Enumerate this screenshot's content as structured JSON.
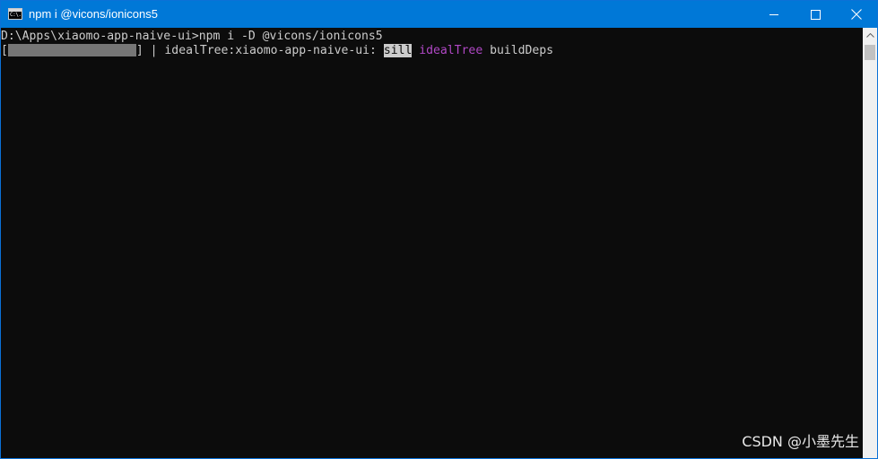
{
  "window": {
    "title": "npm i @vicons/ionicons5",
    "app_icon_text": "C:\\.",
    "accent_color": "#0078d7",
    "icons": {
      "minimize": "minimize-icon",
      "maximize": "maximize-icon",
      "close": "close-icon",
      "scroll_up": "scroll-up-arrow-icon"
    }
  },
  "console": {
    "prompt": "D:\\Apps\\xiaomo-app-naive-ui>npm i -D @vicons/ionicons5",
    "progress": {
      "open_bracket": "[",
      "close_part": "] | idealTree:xiaomo-app-naive-ui: ",
      "sill": "sill",
      "space": " ",
      "idealTree": "idealTree",
      "buildDeps": " buildDeps"
    }
  },
  "watermark": {
    "text": "CSDN @小墨先生"
  }
}
